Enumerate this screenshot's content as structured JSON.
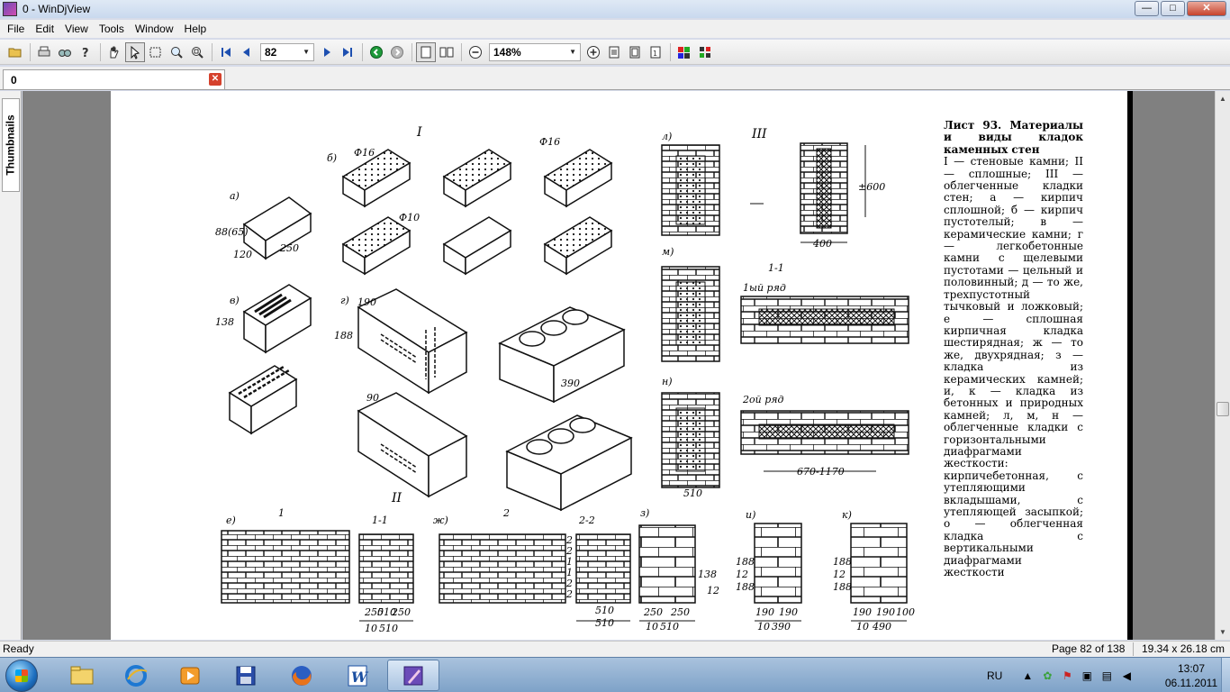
{
  "window": {
    "title": "0 - WinDjView",
    "min_glyph": "—",
    "max_glyph": "□",
    "close_glyph": "✕"
  },
  "menu": [
    "File",
    "Edit",
    "View",
    "Tools",
    "Window",
    "Help"
  ],
  "toolbar": {
    "page_number": "82",
    "zoom": "148%",
    "combo_arrow": "▼"
  },
  "tab": {
    "label": "0",
    "close_glyph": "✕"
  },
  "sidebar": {
    "thumbnails_label": "Thumbnails"
  },
  "document": {
    "header_roman": "I",
    "roman_2": "II",
    "roman_3": "III",
    "caption_head": "Лист 93. Материалы и виды кладок каменных стен",
    "caption_body": "I — стеновые камни; II — сплошные; III — облегченные кладки стен; а — кирпич сплошной; б — кирпич пустотелый; в — керамические камни; г — легкобетонные камни с щелевыми пустотами — цельный и половинный; д — то же, трехпустотный тычковый и ложковый; е — сплошная кирпичная кладка шестирядная; ж — то же, двухрядная; з — кладка из керамических камней; и, к — кладка из бетонных и природных камней; л, м, н — облегченные кладки с горизонтальными диафрагмами жесткости: кирпичебетонная, с утепляющими вкладышами, с утепляющей засыпкой; о — облегченная кладка с вертикальными диафрагмами жесткости",
    "labels": {
      "a": "а)",
      "b": "б)",
      "v": "в)",
      "g": "г)",
      "e": "е)",
      "zh": "ж)",
      "z": "з)",
      "i": "и)",
      "k": "к)",
      "l": "л)",
      "m": "м)",
      "n": "н)",
      "phi16a": "Ф16",
      "phi16b": "Ф16",
      "phi10": "Ф10",
      "d250": "250",
      "d120": "120",
      "d88": "88",
      "d65": "(65)",
      "d138": "138",
      "d190": "190",
      "d390": "390",
      "d188": "188",
      "d90": "90",
      "sec11": "1-1",
      "sec22": "2-2",
      "row1": "1ый ряд",
      "row2": "2ой ряд",
      "span": "670-1170",
      "w510": "510",
      "w400": "400",
      "h600": "±600",
      "num1": "1",
      "num2": "2",
      "r1": "2",
      "r2": "2",
      "r3": "1",
      "r4": "1",
      "r5": "2",
      "r6": "2",
      "dim250a": "250",
      "dim250b": "250",
      "dim510a": "510",
      "dim510b": "510",
      "dim510c": "510",
      "dim10a": "10",
      "dim_z250": "250",
      "dim_z250b": "250",
      "dim_z510": "510",
      "dim_z138": "138",
      "dim_z12": "12",
      "dim_z10": "10",
      "dim_i190a": "190",
      "dim_i190b": "190",
      "dim_i390": "390",
      "dim_i188": "188",
      "dim_i12": "12",
      "dim_i188b": "188",
      "dim_i10": "10",
      "dim_k190a": "190",
      "dim_k190b": "190",
      "dim_k100": "100",
      "dim_k490": "490",
      "dim_k188": "188",
      "dim_k12": "12",
      "dim_k188b": "188",
      "dim_k10": "10",
      "dim_j510": "510"
    }
  },
  "status": {
    "ready": "Ready",
    "page": "Page 82 of 138",
    "size": "19.34 x 26.18 cm"
  },
  "taskbar": {
    "lang": "RU",
    "time": "13:07",
    "date": "06.11.2011"
  },
  "colors": {
    "accent_close": "#c7432c",
    "taskbar": "#7ea2c8",
    "document_bg": "#808080"
  }
}
